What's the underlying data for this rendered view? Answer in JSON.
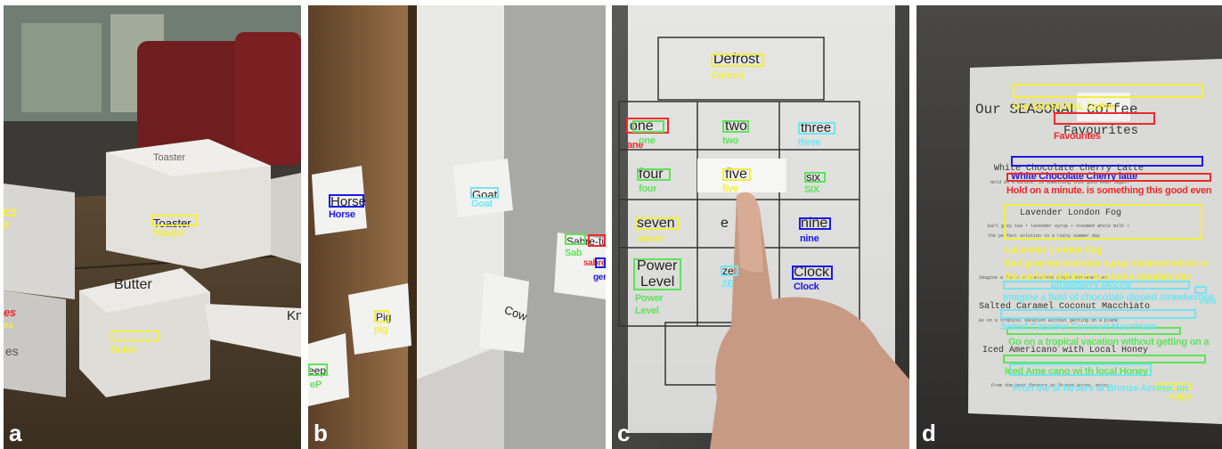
{
  "colors": {
    "yellow": "#f4ef3c",
    "green": "#5fe35a",
    "cyan": "#6fe6f4",
    "blue": "#1a1ae8",
    "red": "#ec2a2a"
  },
  "panel_letters": [
    "a",
    "b",
    "c",
    "d"
  ],
  "panel_a": {
    "printed": {
      "toaster_top": "Toaster",
      "toaster": "Toaster",
      "butter": "Butter",
      "knife": "Kn",
      "es": "es"
    },
    "labels": {
      "p": "p",
      "toaster": "Toaster",
      "es": "es",
      "es2": "es",
      "butter": "Butter"
    }
  },
  "panel_b": {
    "printed": {
      "horse": "Horse",
      "goat": "Goat",
      "cow": "Cow",
      "pig": "Pig",
      "sabre": "Sabre-tu",
      "sheep": "eep"
    },
    "labels": {
      "horse": "Horse",
      "goat": "Goat",
      "sab": "Sab",
      "red": "sabre-tu",
      "ger": "ger",
      "pig": "pig",
      "ep": "eP"
    }
  },
  "panel_c": {
    "printed": {
      "defrost": "Defrost",
      "one": "one",
      "two": "two",
      "three": "three",
      "four": "four",
      "five": "five",
      "six": "six",
      "seven": "seven",
      "eight": "e",
      "nine": "nine",
      "power": "Power",
      "level": "Level",
      "ze": "ze",
      "clock": "Clock"
    },
    "labels": {
      "defrost": "Defrost",
      "one_red": "ane",
      "one": "one",
      "two": "two",
      "three": "three",
      "four": "four",
      "five": "five",
      "six": "SIX",
      "seven": "seven",
      "nine": "nine",
      "power": "Power",
      "level": "Level",
      "ze": "ZE",
      "clock": "Clock"
    }
  },
  "panel_d": {
    "printed": {
      "title": "Our SEASONAL Coffee",
      "favourites": "Favourites",
      "latte": "White Chocolate Cherry Latte",
      "latte_desc": "Hold on a minute. is something this good even legal?",
      "london": "Lavender London Fog",
      "london_desc": "Earl grey tea • lavender syrup • steamed whole milk •",
      "london_desc2": "the perfect solution to a rainy summer day",
      "mocha_desc": "Imagine a field of chocolate dipped strawberries",
      "macchiato": "Salted Caramel Coconut Macchiato",
      "macchiato_desc": "Go on a tropical vacation without getting on a plane",
      "americano": "Iced Americano with Local Honey",
      "americano_desc": "From the best farmers at Bronze Acres, enjoy"
    },
    "labels": {
      "title": "Our SEASONAL Coffee",
      "favourites": "Favourites",
      "latte": "White Chocolate Cherry latte",
      "latte_desc": "Hold on a minute. is something this good even",
      "london": "Lavender London Fog",
      "london_desc": "Earl grey tea lavender syrup steamed whole m",
      "london_desc2": "the perfect solution to a rainy summer day",
      "mocha": "Strawberry Mocha",
      "mocha_desc": "Imagine a field of chocolate dipped strawberries",
      "rum": "rum",
      "macchiato": "Salted Cazamel Coconut Macchiato",
      "macchiato_desc": "Go on a tropical vacation without getting on a",
      "americano": "Iced Ame cano wi th local Honey",
      "americano_desc": "Fron the st farsers at Bronze Acrese, on",
      "enjoy": "enjoy"
    }
  }
}
